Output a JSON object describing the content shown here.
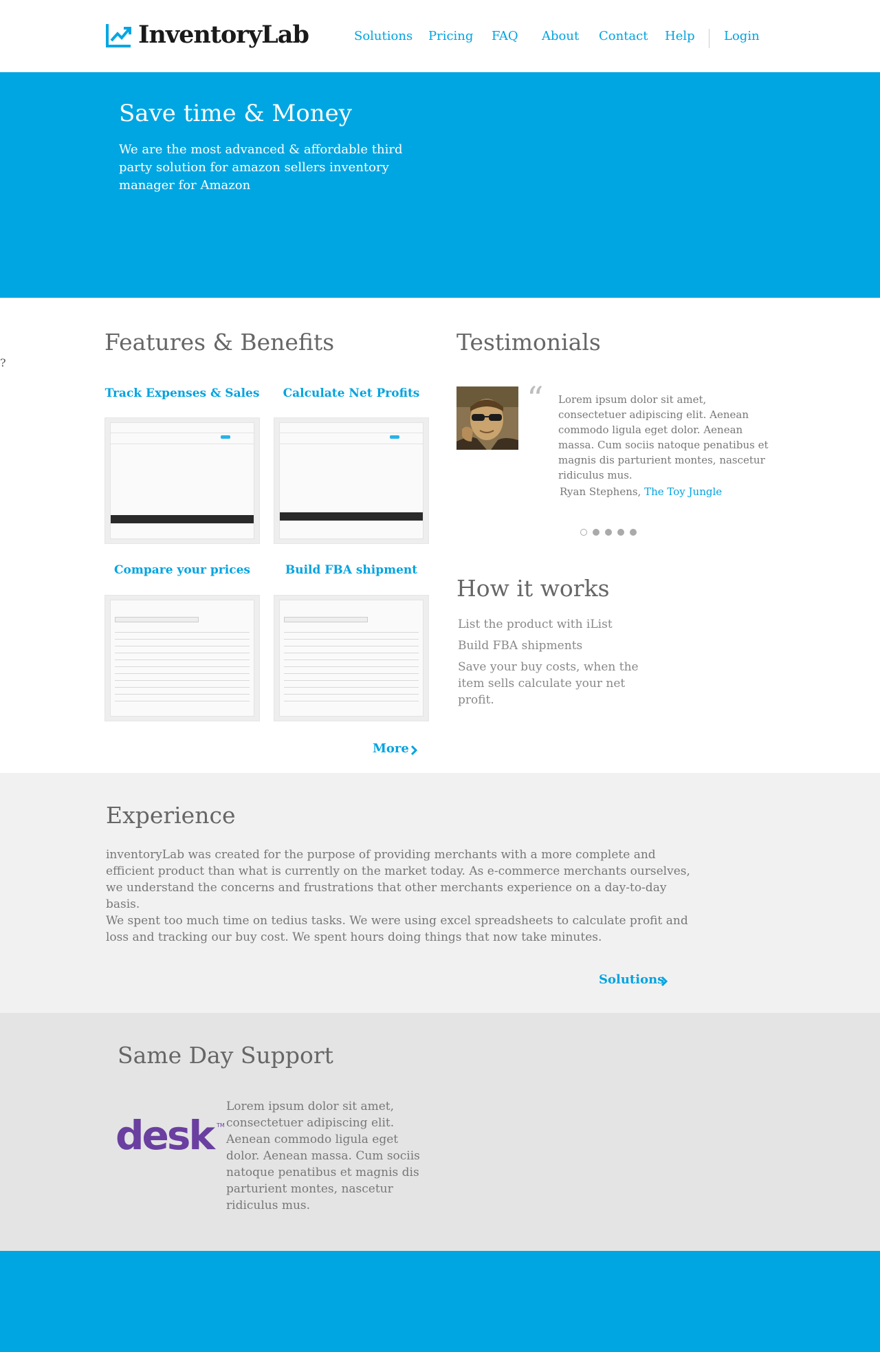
{
  "header": {
    "logo_text": "InventoryLab",
    "nav": [
      "Solutions",
      "Pricing",
      "FAQ",
      "About",
      "Contact",
      "Help"
    ],
    "login": "Login"
  },
  "hero": {
    "title": "Save time & Money",
    "subtitle": "We are the most advanced & affordable third party solution for amazon sellers inventory manager for Amazon"
  },
  "features": {
    "title": "Features & Benefits",
    "items": [
      {
        "label": "Track Expenses & Sales"
      },
      {
        "label": "Calculate Net Profits"
      },
      {
        "label": "Compare your prices"
      },
      {
        "label": "Build FBA shipment"
      }
    ],
    "more": "More"
  },
  "testimonials": {
    "title": "Testimonials",
    "quote": "Lorem ipsum dolor sit amet, consectetuer adipiscing elit. Aenean commodo ligula eget dolor. Aenean massa. Cum sociis natoque penatibus et magnis dis parturient montes, nascetur ridiculus mus.",
    "author": "Ryan Stephens,",
    "company": "The Toy Jungle",
    "slides": 5,
    "active_slide": 1
  },
  "how_it_works": {
    "title": "How it works",
    "steps": [
      "List the product with iList",
      "Build FBA shipments",
      "Save your buy costs, when the item sells calculate your net profit."
    ]
  },
  "experience": {
    "title": "Experience",
    "paragraphs": [
      "inventoryLab was created for the purpose of providing merchants with a more complete and efficient product than what is currently on the market today. As e-commerce merchants ourselves, we understand the concerns and frustrations that other merchants experience on a day-to-day basis.",
      "We spent too much time on tedius tasks. We were using excel spreadsheets to calculate profit and loss and tracking our buy cost. We spent hours doing things that now take minutes."
    ],
    "link": "Solutions"
  },
  "support": {
    "title": "Same Day Support",
    "logo_text": "desk",
    "logo_tm": "TM",
    "text": "Lorem ipsum dolor sit amet, consectetuer adipiscing elit. Aenean commodo ligula eget dolor. Aenean massa. Cum sociis natoque penatibus et magnis dis parturient montes, nascetur ridiculus mus."
  },
  "stray_char": "?",
  "colors": {
    "accent": "#00a3e0",
    "hero_bg": "#00a6e2",
    "desk_purple": "#6a3fa0"
  }
}
